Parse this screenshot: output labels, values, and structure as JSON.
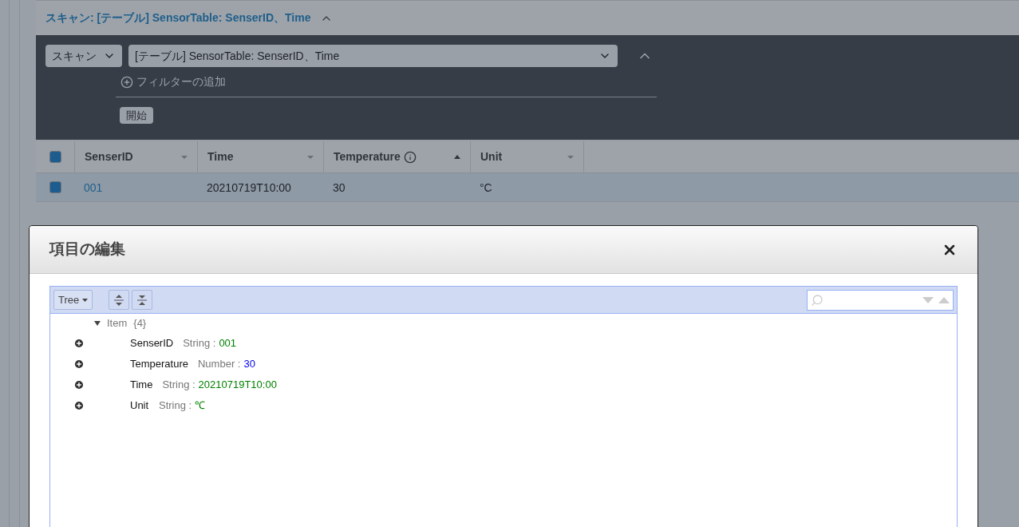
{
  "scan_header": {
    "title": "スキャン: [テーブル] SensorTable: SenserID、Time",
    "expanded": true
  },
  "scan_panel": {
    "mode": "スキャン",
    "target": "[テーブル] SensorTable: SenserID、Time",
    "add_filter": "フィルターの追加",
    "start_button": "開始"
  },
  "table": {
    "all_checked": true,
    "columns": [
      {
        "label": "SenserID",
        "sorted": false,
        "info": false
      },
      {
        "label": "Time",
        "sorted": false,
        "info": false
      },
      {
        "label": "Temperature",
        "sorted": true,
        "info": true
      },
      {
        "label": "Unit",
        "sorted": false,
        "info": false
      }
    ],
    "rows": [
      {
        "selected": true,
        "cells": [
          "001",
          "20210719T10:00",
          "30",
          "°C"
        ]
      }
    ]
  },
  "dialog": {
    "title": "項目の編集",
    "view_button": "Tree",
    "tree": {
      "label": "Item",
      "count": "{4}",
      "expanded": true,
      "children": [
        {
          "name": "SenserID",
          "type": "String :",
          "value": "001",
          "kind": "string"
        },
        {
          "name": "Temperature",
          "type": "Number :",
          "value": "30",
          "kind": "number"
        },
        {
          "name": "Time",
          "type": "String :",
          "value": "20210719T10:00",
          "kind": "string"
        },
        {
          "name": "Unit",
          "type": "String :",
          "value": "℃",
          "kind": "string"
        }
      ]
    }
  }
}
